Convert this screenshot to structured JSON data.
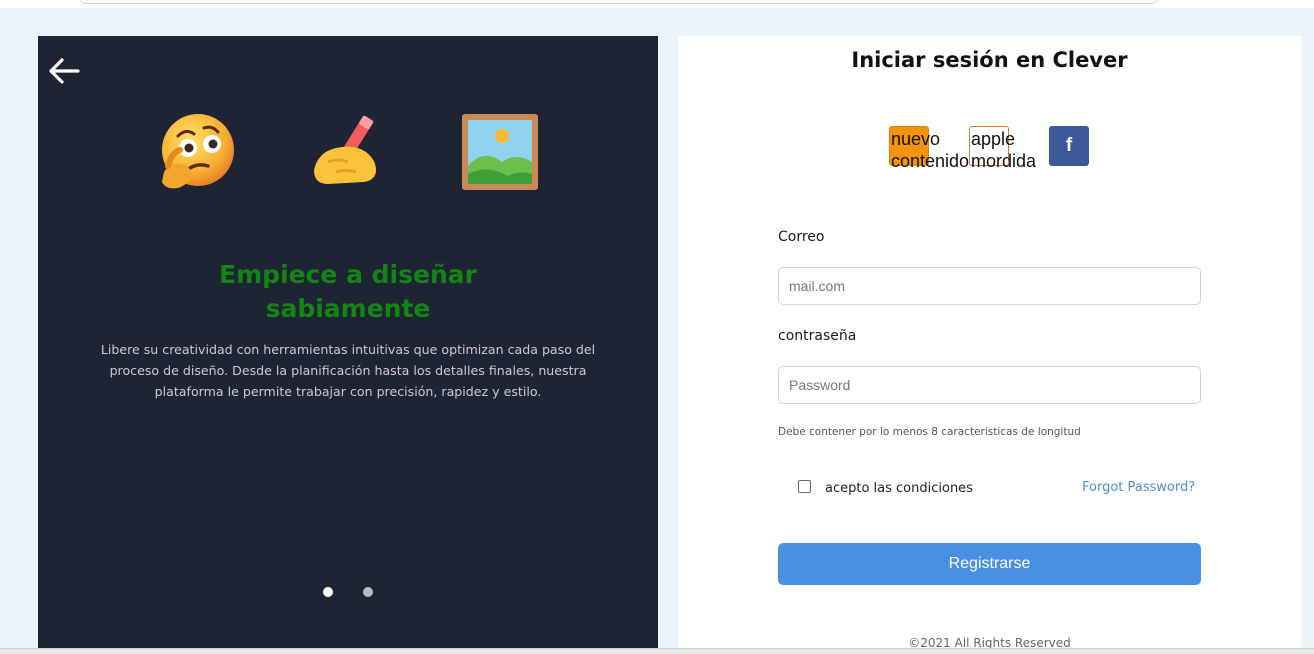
{
  "left_panel": {
    "emojis": [
      "thinking-face",
      "writing-hand",
      "framed-picture"
    ],
    "headline_line1": "Empiece a diseñar",
    "headline_line2": "sabiamente",
    "description": "Libere su creatividad con herramientas intuitivas que optimizan cada paso del proceso de diseño. Desde la planificación hasta los detalles finales, nuestra plataforma le permite trabajar con precisión, rapidez y estilo.",
    "carousel": {
      "count": 2,
      "active": 1
    }
  },
  "login": {
    "title": "Iniciar sesión en Clever",
    "social": {
      "google_alt": "nuevo contenido",
      "apple_alt": "apple mordida",
      "facebook_label": "f"
    },
    "email_label": "Correo",
    "email_placeholder": "mail.com",
    "password_label": "contraseña",
    "password_placeholder": "Password",
    "password_hint": "Debe contener por lo menos 8 caracteristicas de longitud",
    "terms_label": "acepto las condiciones",
    "forgot_label": "Forgot Password?",
    "submit_label": "Registrarse",
    "footer": "©2021 All Rights Reserved"
  },
  "colors": {
    "left_bg": "#1f2435",
    "headline": "#118610",
    "accent": "#4a90e2",
    "facebook": "#3b5998",
    "google_box": "#f5930d"
  }
}
